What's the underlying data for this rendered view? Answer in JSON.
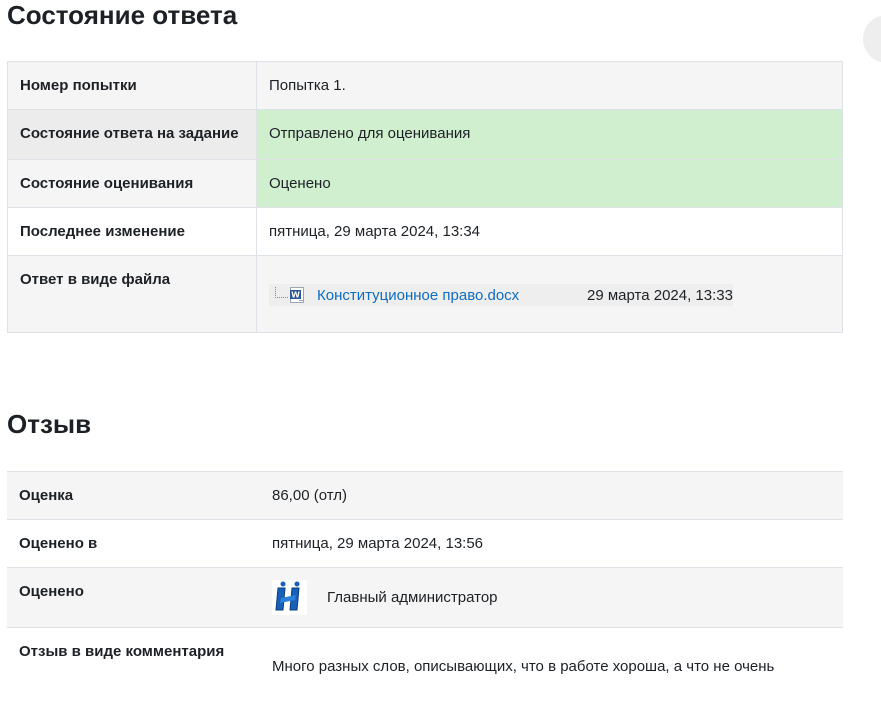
{
  "submission": {
    "heading": "Состояние ответа",
    "rows": {
      "attempt_label": "Номер попытки",
      "attempt_value": "Попытка 1.",
      "status_label": "Состояние ответа на задание",
      "status_value": "Отправлено для оценивания",
      "grading_label": "Состояние оценивания",
      "grading_value": "Оценено",
      "modified_label": "Последнее изменение",
      "modified_value": "пятница, 29 марта 2024, 13:34",
      "file_label": "Ответ в виде файла",
      "file_name": "Конституционное право.docx",
      "file_date": "29 марта 2024, 13:33"
    }
  },
  "feedback": {
    "heading": "Отзыв",
    "rows": {
      "grade_label": "Оценка",
      "grade_value": "86,00 (отл)",
      "graded_on_label": "Оценено в",
      "graded_on_value": "пятница, 29 марта 2024, 13:56",
      "graded_by_label": "Оценено",
      "graded_by_value": "Главный администратор",
      "comment_label": "Отзыв в виде комментария",
      "comment_value": "Много разных слов, описывающих, что в работе хороша, а что не очень"
    }
  },
  "icons": {
    "file_icon": "word-document-icon",
    "avatar": "user-avatar-icon"
  },
  "colors": {
    "success_bg": "#cfefcf",
    "link": "#0f6cbf"
  }
}
